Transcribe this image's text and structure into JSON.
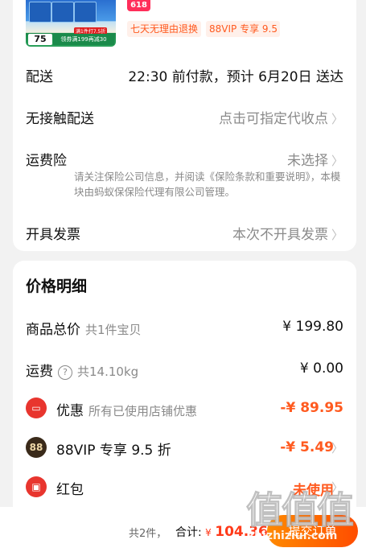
{
  "product": {
    "badge_618": "618",
    "thumb_price": "75",
    "thumb_promo": "领券满199再减30",
    "thumb_deal": "满1件打7.5折",
    "service_tags": [
      "七天无理由退换",
      "88VIP 专享 9.5 折"
    ]
  },
  "order_options": {
    "delivery": {
      "label": "配送",
      "value": "22:30 前付款，预计 6月20日 送达"
    },
    "contactless": {
      "label": "无接触配送",
      "value": "点击可指定代收点"
    },
    "shipping_insurance": {
      "label": "运费险",
      "value": "未选择",
      "note": "请关注保险公司信息，并阅读《保险条款和重要说明》，本模块由蚂蚁保保险代理有限公司管理。"
    },
    "invoice": {
      "label": "开具发票",
      "value": "本次不开具发票"
    }
  },
  "price_detail": {
    "title": "价格明细",
    "rows": {
      "goods_total": {
        "label": "商品总价",
        "sub": "共1件宝贝",
        "amount": "¥ 199.80"
      },
      "shipping": {
        "label": "运费",
        "sub": "共14.10kg",
        "amount": "¥ 0.00"
      },
      "discount": {
        "label": "优惠",
        "sub": "所有已使用店铺优惠",
        "amount": "-¥ 89.95"
      },
      "vip": {
        "label": "88VIP 专享 9.5 折",
        "amount": "-¥ 5.49",
        "icon_text": "88"
      },
      "red_packet": {
        "label": "红包",
        "amount": "未使用"
      }
    }
  },
  "bottom_bar": {
    "count": "共2件，",
    "total_label": "合计:",
    "currency": "¥",
    "total": "104.36",
    "submit_label": "提交订单"
  },
  "watermark": {
    "glyphs": "值值值",
    "url": "zhizhiziui.com"
  },
  "colors": {
    "accent": "#ff5a1f",
    "submit_start": "#ff8a00",
    "submit_end": "#ff4d00",
    "muted": "#8a8a8a"
  },
  "icons": {
    "chevron": "chevron-right-icon",
    "help": "question-circle-icon",
    "coupon": "coupon-icon",
    "vip": "vip-88-icon",
    "redpacket": "red-packet-icon"
  }
}
